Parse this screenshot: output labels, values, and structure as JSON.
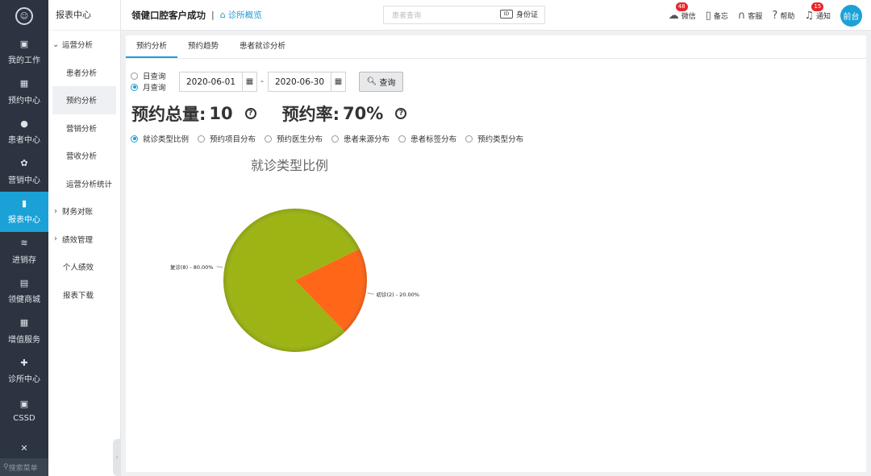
{
  "rail": {
    "items": [
      {
        "label": "我的工作",
        "icon": "monitor-icon"
      },
      {
        "label": "预约中心",
        "icon": "calendar-icon"
      },
      {
        "label": "患者中心",
        "icon": "user-icon"
      },
      {
        "label": "营销中心",
        "icon": "marketing-icon"
      },
      {
        "label": "报表中心",
        "icon": "bar-chart-icon"
      },
      {
        "label": "进销存",
        "icon": "layers-icon"
      },
      {
        "label": "领健商城",
        "icon": "shop-icon"
      },
      {
        "label": "增值服务",
        "icon": "grid-icon"
      },
      {
        "label": "诊所中心",
        "icon": "clinic-icon"
      },
      {
        "label": "CSSD",
        "icon": "cssd-icon"
      },
      {
        "label": "",
        "icon": "tools-icon"
      }
    ],
    "search_label": "搜索菜单"
  },
  "submenu": {
    "title": "报表中心",
    "items": [
      {
        "label": "运营分析",
        "kind": "group-open"
      },
      {
        "label": "患者分析",
        "kind": "child"
      },
      {
        "label": "预约分析",
        "kind": "child-active"
      },
      {
        "label": "营销分析",
        "kind": "child"
      },
      {
        "label": "营收分析",
        "kind": "child"
      },
      {
        "label": "运营分析统计",
        "kind": "child"
      },
      {
        "label": "财务对账",
        "kind": "group-closed"
      },
      {
        "label": "绩效管理",
        "kind": "group-closed"
      },
      {
        "label": "个人绩效",
        "kind": "top"
      },
      {
        "label": "报表下载",
        "kind": "top"
      }
    ]
  },
  "header": {
    "clinic_name": "领健口腔客户成功",
    "separator": "|",
    "clinic_link": "诊所概览",
    "search_placeholder": "患者查询",
    "id_card_label": "身份证",
    "tools": {
      "wechat": {
        "label": "微信",
        "badge": "48"
      },
      "memo": {
        "label": "备忘"
      },
      "service": {
        "label": "客服"
      },
      "help": {
        "label": "帮助"
      },
      "notice": {
        "label": "通知",
        "badge": "15"
      }
    },
    "avatar": "前台"
  },
  "tabs": [
    {
      "label": "预约分析",
      "active": true
    },
    {
      "label": "预约趋势",
      "active": false
    },
    {
      "label": "患者就诊分析",
      "active": false
    }
  ],
  "query": {
    "day_label": "日查询",
    "month_label": "月查询",
    "selected": "month",
    "start_date": "2020-06-01",
    "end_date": "2020-06-30",
    "dash": "-",
    "button": "查询"
  },
  "stats": {
    "total_label": "预约总量:",
    "total_value": "10",
    "rate_label": "预约率:",
    "rate_value": "70%"
  },
  "chart_tabs": [
    {
      "label": "就诊类型比例",
      "selected": true
    },
    {
      "label": "预约项目分布",
      "selected": false
    },
    {
      "label": "预约医生分布",
      "selected": false
    },
    {
      "label": "患者来源分布",
      "selected": false
    },
    {
      "label": "患者标签分布",
      "selected": false
    },
    {
      "label": "预约类型分布",
      "selected": false
    }
  ],
  "chart_data": {
    "type": "pie",
    "title": "就诊类型比例",
    "slices": [
      {
        "name": "复诊",
        "count": 8,
        "percent": 80.0,
        "color": "#9db414",
        "label": "复诊(8) - 80.00%"
      },
      {
        "name": "初诊",
        "count": 2,
        "percent": 20.0,
        "color": "#ff6617",
        "label": "初诊(2) - 20.00%"
      }
    ]
  }
}
